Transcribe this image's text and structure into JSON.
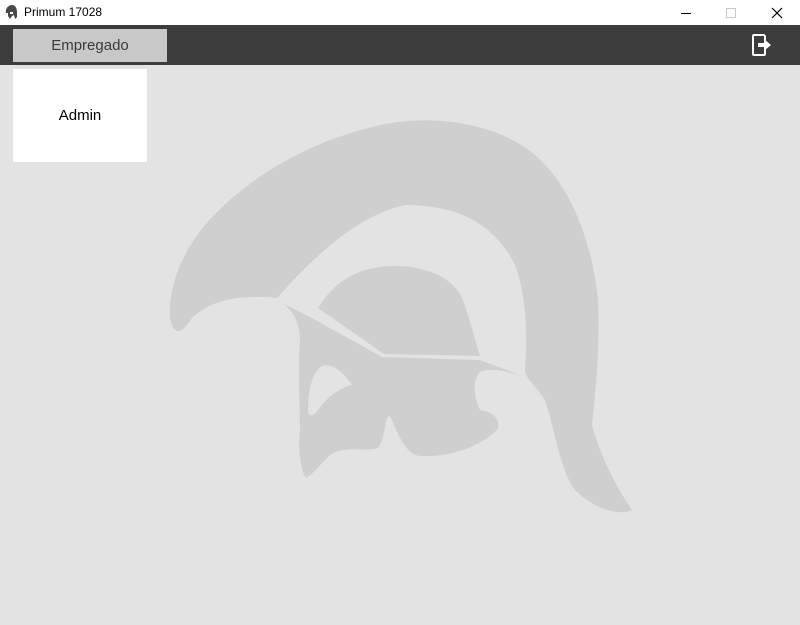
{
  "window": {
    "title": "Primum 17028",
    "app_icon": "spartan-helmet-icon"
  },
  "toolbar": {
    "tab_label": "Empregado",
    "logout_icon": "logout-icon"
  },
  "content": {
    "users": [
      {
        "label": "Admin"
      }
    ],
    "watermark_icon": "spartan-helmet-logo"
  },
  "colors": {
    "titlebar_bg": "#ffffff",
    "toolbar_bg": "#3c3c3c",
    "tab_bg": "#c8c8c8",
    "content_bg": "#e3e3e3",
    "card_bg": "#ffffff",
    "watermark": "#d0cfd0"
  }
}
